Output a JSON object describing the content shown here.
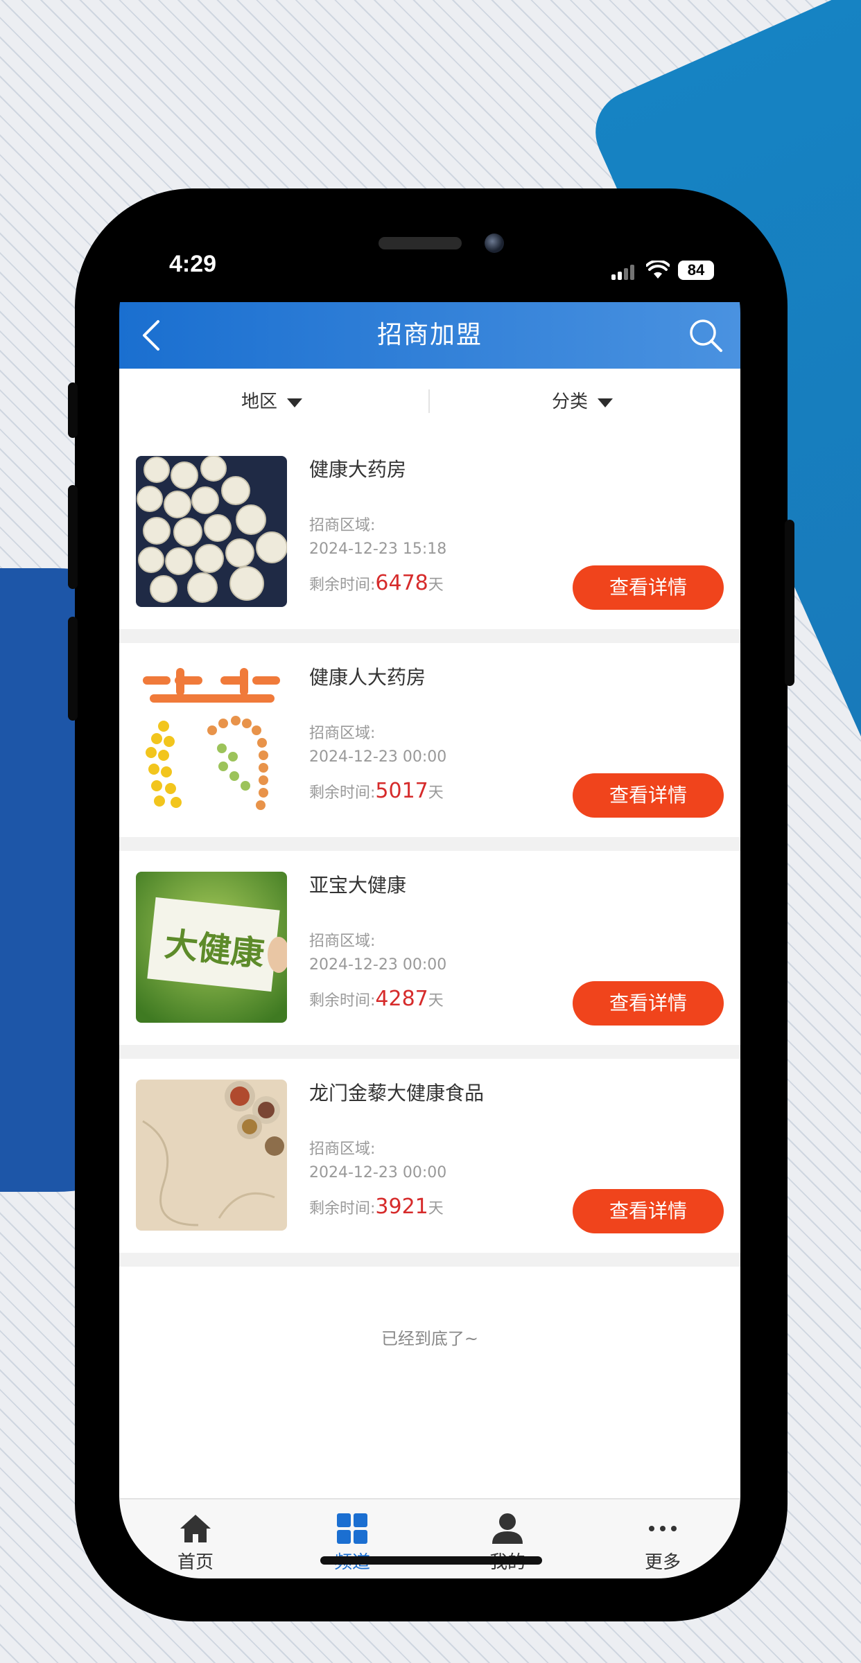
{
  "status_bar": {
    "time": "4:29",
    "battery": "84"
  },
  "header": {
    "title": "招商加盟"
  },
  "filters": [
    {
      "label": "地区"
    },
    {
      "label": "分类"
    }
  ],
  "listings": [
    {
      "title": "健康大药房",
      "region_label": "招商区域:",
      "date": "2024-12-23 15:18",
      "remain_label": "剩余时间:",
      "days": "6478",
      "days_unit": "天",
      "button": "查看详情",
      "image": "white-pills"
    },
    {
      "title": "健康人大药房",
      "region_label": "招商区域:",
      "date": "2024-12-23 00:00",
      "remain_label": "剩余时间:",
      "days": "5017",
      "days_unit": "天",
      "button": "查看详情",
      "image": "pills-character"
    },
    {
      "title": "亚宝大健康",
      "region_label": "招商区域:",
      "date": "2024-12-23 00:00",
      "remain_label": "剩余时间:",
      "days": "4287",
      "days_unit": "天",
      "button": "查看详情",
      "image": "health-sign"
    },
    {
      "title": "龙门金藜大健康食品",
      "region_label": "招商区域:",
      "date": "2024-12-23 00:00",
      "remain_label": "剩余时间:",
      "days": "3921",
      "days_unit": "天",
      "button": "查看详情",
      "image": "herbs"
    }
  ],
  "thumb_text": {
    "health_sign": "大健康"
  },
  "end_text": "已经到底了~",
  "tabs": [
    {
      "label": "首页",
      "icon": "home-icon"
    },
    {
      "label": "频道",
      "icon": "grid-icon",
      "active": true
    },
    {
      "label": "我的",
      "icon": "user-icon"
    },
    {
      "label": "更多",
      "icon": "more-icon"
    }
  ],
  "colors": {
    "accent": "#1b6fd1",
    "button": "#f0441c",
    "days": "#d62b2b"
  }
}
